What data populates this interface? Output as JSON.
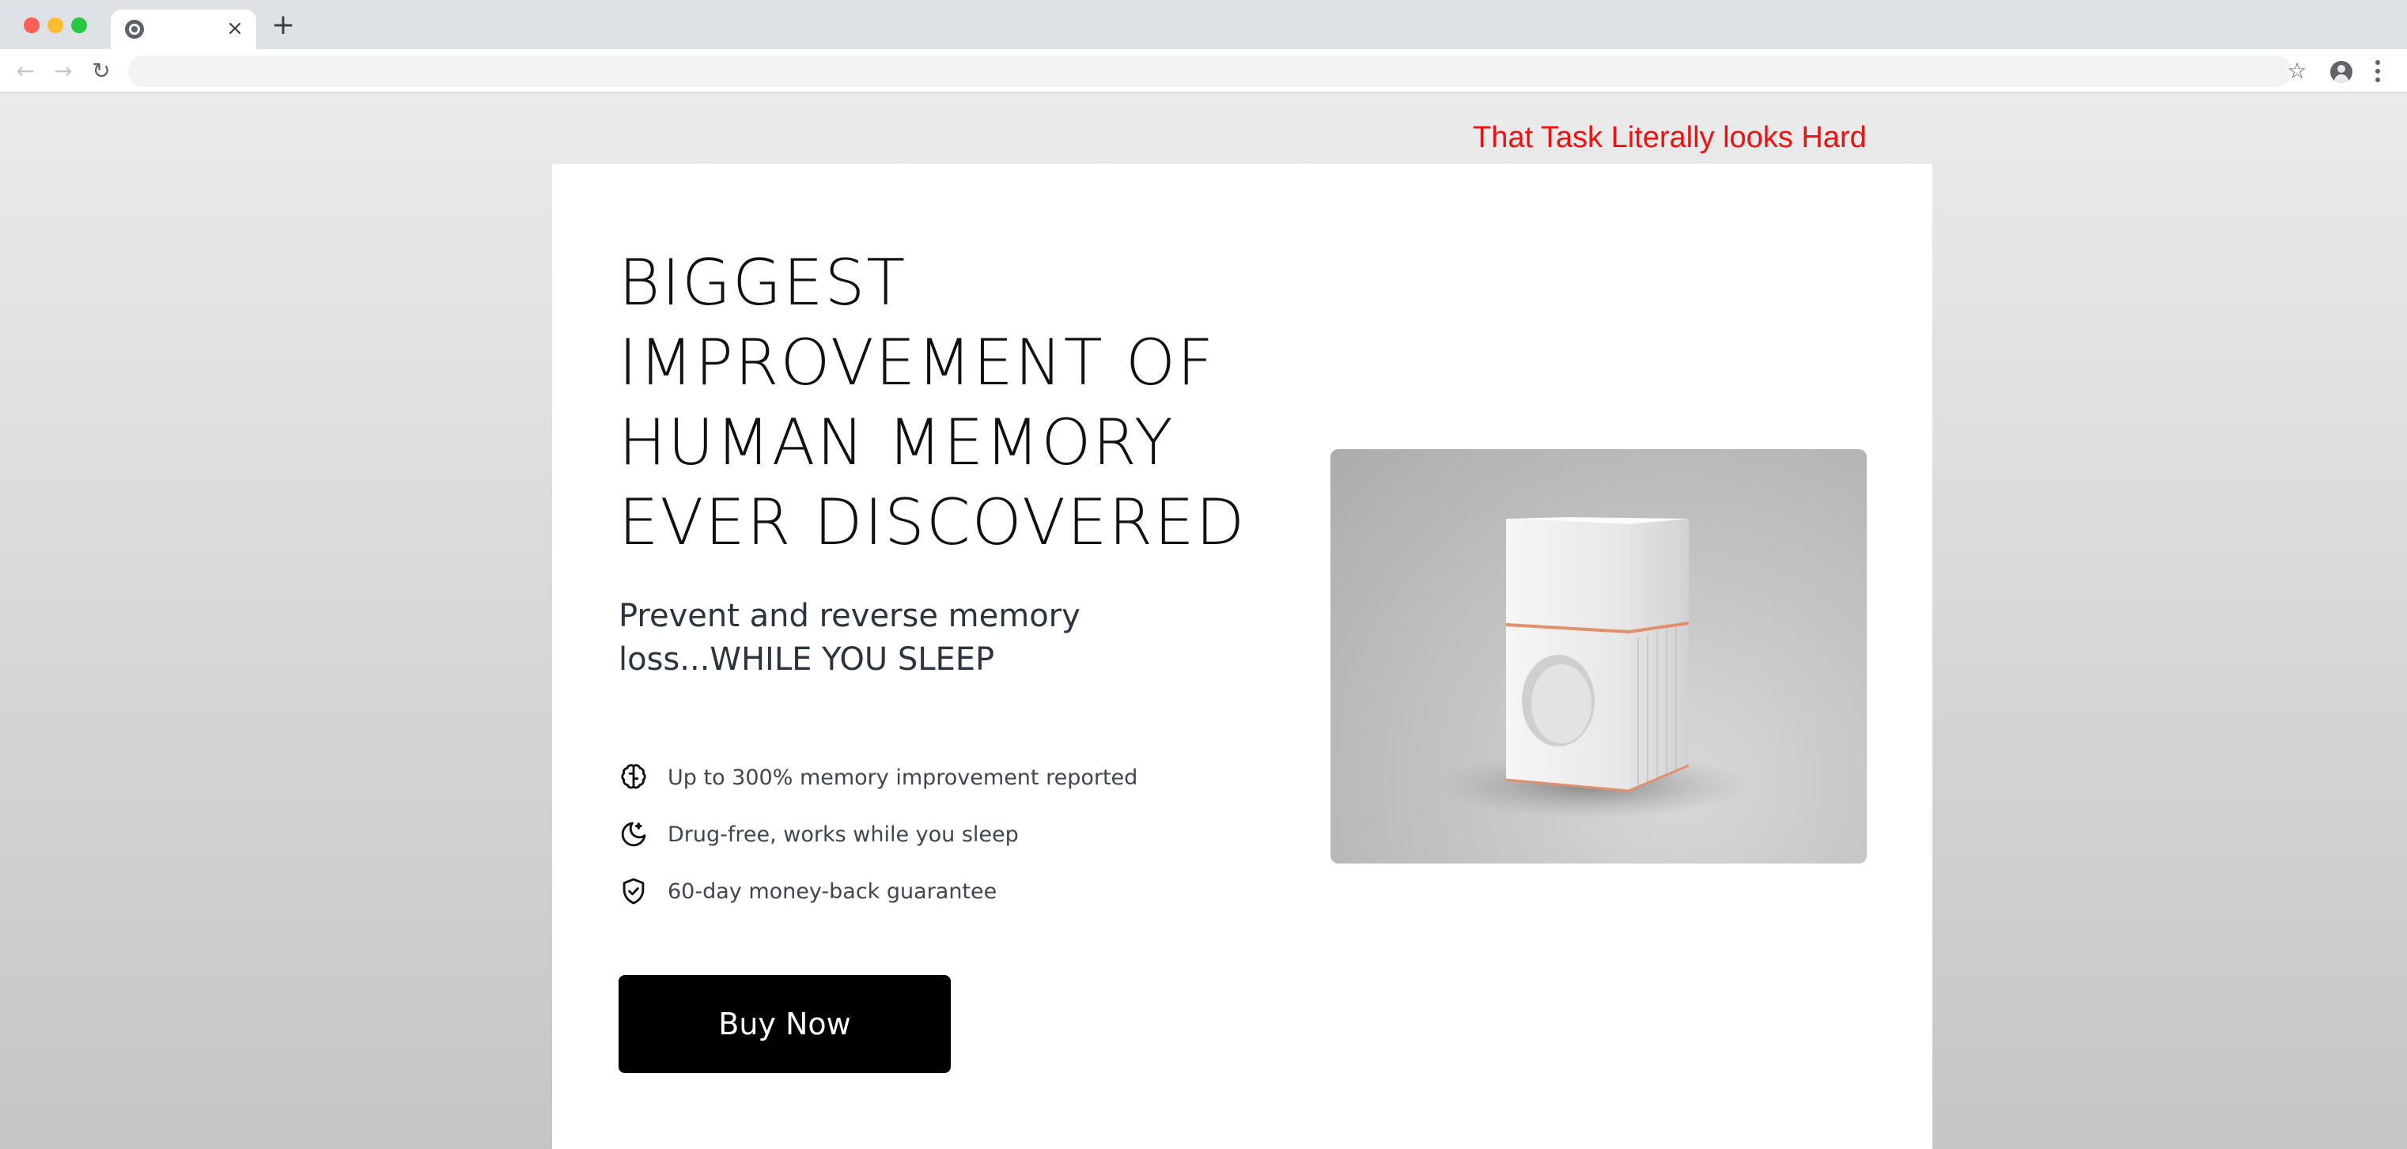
{
  "browser": {
    "tab_close_glyph": "×",
    "new_tab_glyph": "+",
    "address": ""
  },
  "page": {
    "caption": "That Task Literally looks Hard",
    "headline": [
      "BIGGEST",
      "IMPROVEMENT OF",
      "HUMAN MEMORY",
      "EVER DISCOVERED"
    ],
    "subheadline": "Prevent and reverse memory loss...WHILE YOU SLEEP",
    "features": [
      {
        "icon": "brain-icon",
        "text": "Up to 300% memory improvement reported"
      },
      {
        "icon": "moon-icon",
        "text": "Drug-free, works while you sleep"
      },
      {
        "icon": "shield-check-icon",
        "text": "60-day money-back guarantee"
      }
    ],
    "cta_label": "Buy Now"
  },
  "colors": {
    "caption": "#ee1111",
    "cta_background": "#000000",
    "cta_text": "#ffffff",
    "product_accent": "#e0906d"
  }
}
